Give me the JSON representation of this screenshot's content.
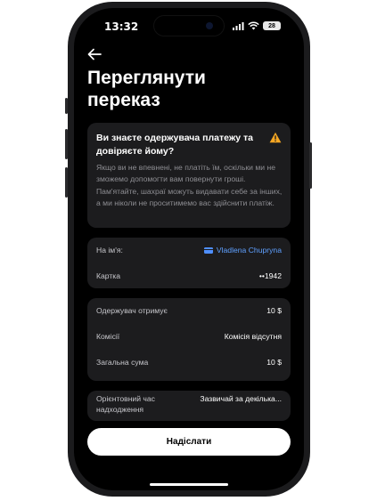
{
  "status_bar": {
    "time": "13:32",
    "battery": "28"
  },
  "header": {
    "back_icon": "arrow-left-icon",
    "title_line1": "Переглянути",
    "title_line2": "переказ"
  },
  "warning": {
    "title": "Ви знаєте одержувача платежу та довіряєте йому?",
    "body": "Якщо ви не впевнені, не платіть їм, оскільки ми не зможемо допомогти вам повернути гроші. Пам'ятайте, шахраї можуть видавати себе за інших, а ми ніколи не проситимемо вас здійснити платіж.",
    "icon": "warning-triangle-icon",
    "icon_color": "#f5a623"
  },
  "recipient": {
    "name_label": "На ім'я:",
    "name_value": "Vladlena Chupryna",
    "card_label": "Картка",
    "card_value": "••1942",
    "link_color": "#5fa0ff"
  },
  "amounts": {
    "receives_label": "Одержувач отримує",
    "receives_value": "10 $",
    "fee_label": "Комісії",
    "fee_value": "Комісія відсутня",
    "total_label": "Загальна сума",
    "total_value": "10 $"
  },
  "eta": {
    "label_line1": "Орієнтовний час",
    "label_line2": "надходження",
    "value": "Зазвичай за декілька..."
  },
  "submit_label": "Надіслати"
}
